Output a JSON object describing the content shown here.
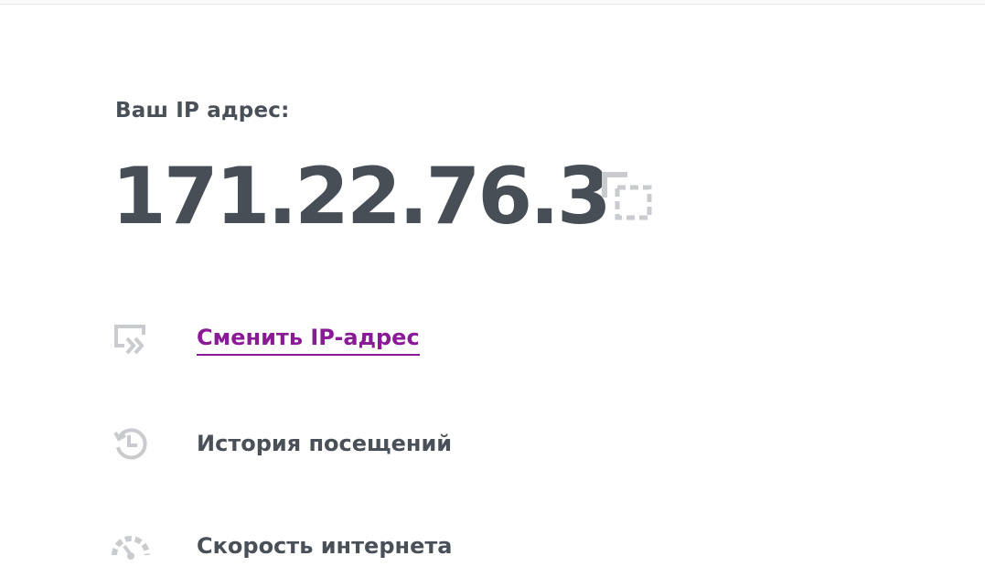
{
  "ip_block": {
    "label": "Ваш IP адрес:",
    "value": "171.22.76.3"
  },
  "menu": {
    "items": [
      {
        "label": "Сменить IP-адрес",
        "icon": "change-ip-icon",
        "active": true
      },
      {
        "label": "История посещений",
        "icon": "history-icon",
        "active": false
      },
      {
        "label": "Скорость интернета",
        "icon": "speedometer-icon",
        "active": false
      }
    ]
  },
  "colors": {
    "text": "#4a5058",
    "accent": "#8a1a96",
    "icon": "#c9cbcf"
  }
}
